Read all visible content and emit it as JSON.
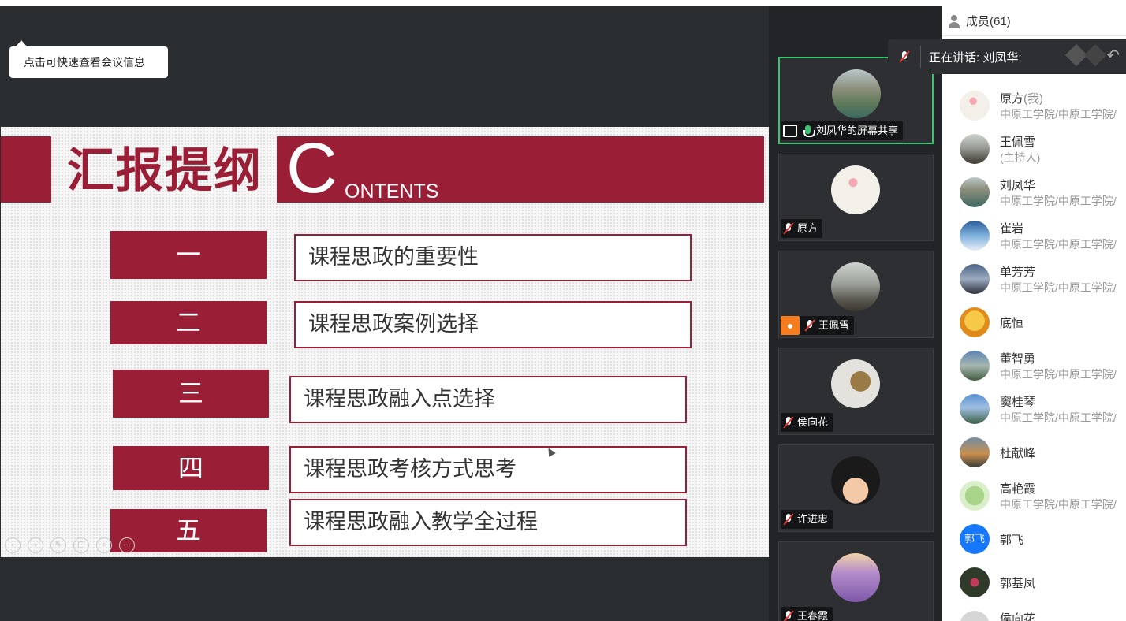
{
  "tooltip": {
    "text": "点击可快速查看会议信息"
  },
  "slide": {
    "title": "汇报提纲",
    "contents_initial": "C",
    "contents_rest": "ONTENTS",
    "items": [
      {
        "num": "一",
        "text": "课程思政的重要性"
      },
      {
        "num": "二",
        "text": "课程思政案例选择"
      },
      {
        "num": "三",
        "text": "课程思政融入点选择"
      },
      {
        "num": "四",
        "text": "课程思政考核方式思考"
      },
      {
        "num": "五",
        "text": "课程思政融入教学全过程"
      }
    ]
  },
  "video_tiles": [
    {
      "label": "刘凤华的屏幕共享",
      "mic": "on",
      "active": true,
      "avatar": "landscape-river",
      "screen_share": true
    },
    {
      "label": "原方",
      "mic": "off",
      "avatar": "balloon-bear"
    },
    {
      "label": "王佩雪",
      "mic": "off",
      "avatar": "sunset-person",
      "user_badge": true
    },
    {
      "label": "侯向花",
      "mic": "off",
      "avatar": "pen"
    },
    {
      "label": "许进忠",
      "mic": "off",
      "avatar": "cartoon-hat"
    },
    {
      "label": "王春霞",
      "mic": "off",
      "avatar": "lavender"
    }
  ],
  "members": {
    "header": "成员(61)",
    "speaking_banner": "正在讲话: 刘凤华;",
    "list": [
      {
        "name": "原方",
        "suffix": "(我)",
        "sub": "中原工学院/中原工学院/"
      },
      {
        "name": "王佩雪",
        "sub": "(主持人)"
      },
      {
        "name": "刘凤华",
        "sub": "中原工学院/中原工学院/"
      },
      {
        "name": "崔岩",
        "sub": "中原工学院/中原工学院/"
      },
      {
        "name": "单芳芳",
        "sub": "中原工学院/中原工学院/"
      },
      {
        "name": "底恒"
      },
      {
        "name": "董智勇",
        "sub": "中原工学院/中原工学院/"
      },
      {
        "name": "窦桂琴",
        "sub": "中原工学院/中原工学院/"
      },
      {
        "name": "杜献峰"
      },
      {
        "name": "高艳霞",
        "sub": "中原工学院/中原工学院/"
      },
      {
        "name": "郭飞",
        "avatar_text": "郭飞"
      },
      {
        "name": "郭基凤"
      },
      {
        "name": "侯向花"
      }
    ]
  },
  "colors": {
    "accent": "#9a1f36",
    "speaking_green": "#3ec270",
    "avatar_blue": "#1677ff"
  }
}
